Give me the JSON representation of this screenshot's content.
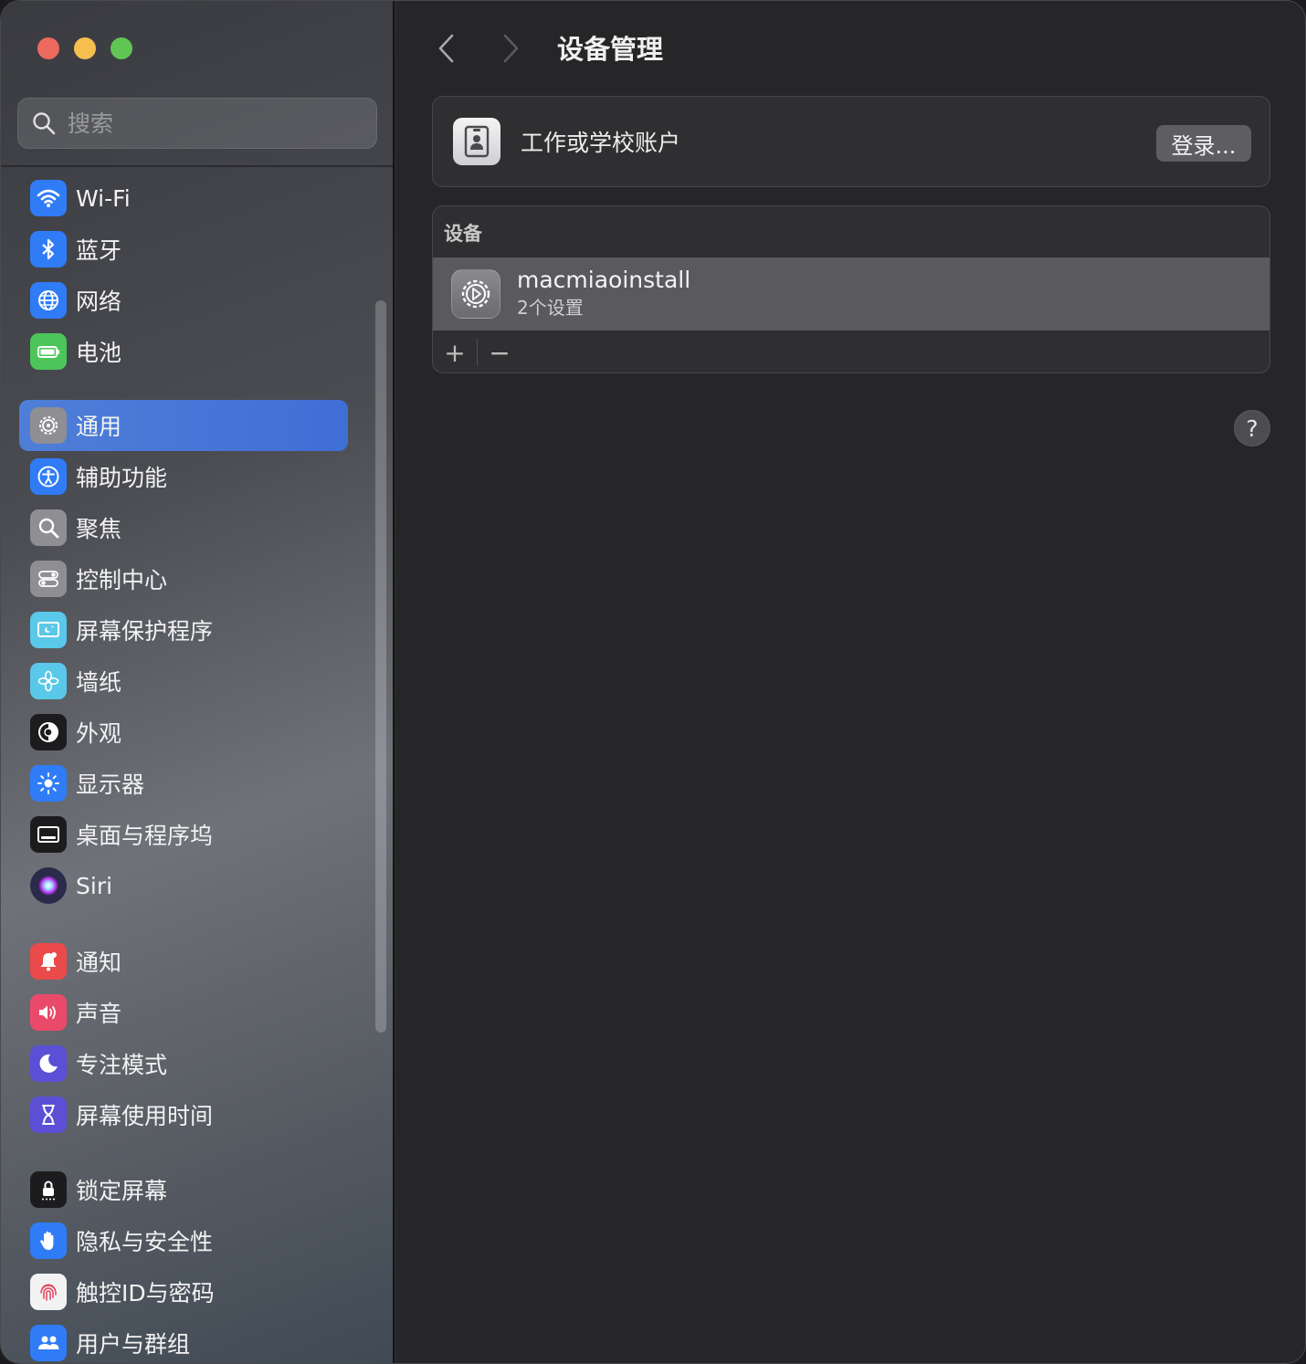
{
  "search": {
    "placeholder": "搜索"
  },
  "sidebar": {
    "items": [
      {
        "label": "Wi-Fi",
        "icon": "wifi-icon",
        "color": "#2f7cf6"
      },
      {
        "label": "蓝牙",
        "icon": "bluetooth-icon",
        "color": "#2f7cf6"
      },
      {
        "label": "网络",
        "icon": "globe-icon",
        "color": "#2f7cf6"
      },
      {
        "label": "电池",
        "icon": "battery-icon",
        "color": "#4cc55a"
      },
      {
        "label": "通用",
        "icon": "gear-icon",
        "color": "#8e8e93",
        "active": true
      },
      {
        "label": "辅助功能",
        "icon": "accessibility-icon",
        "color": "#2f7cf6"
      },
      {
        "label": "聚焦",
        "icon": "spotlight-icon",
        "color": "#8e8e93"
      },
      {
        "label": "控制中心",
        "icon": "toggles-icon",
        "color": "#8e8e93"
      },
      {
        "label": "屏幕保护程序",
        "icon": "screensaver-icon",
        "color": "#5ac8e8"
      },
      {
        "label": "墙纸",
        "icon": "flower-icon",
        "color": "#5ac8e8"
      },
      {
        "label": "外观",
        "icon": "appearance-icon",
        "color": "#1c1c1e"
      },
      {
        "label": "显示器",
        "icon": "sun-icon",
        "color": "#2f7cf6"
      },
      {
        "label": "桌面与程序坞",
        "icon": "dock-icon",
        "color": "#1c1c1e"
      },
      {
        "label": "Siri",
        "icon": "siri-icon",
        "color": "#2a2a4a"
      },
      {
        "label": "通知",
        "icon": "bell-icon",
        "color": "#ea4a4a"
      },
      {
        "label": "声音",
        "icon": "speaker-icon",
        "color": "#ea4a6a"
      },
      {
        "label": "专注模式",
        "icon": "moon-icon",
        "color": "#5b4fd6"
      },
      {
        "label": "屏幕使用时间",
        "icon": "hourglass-icon",
        "color": "#5b4fd6"
      },
      {
        "label": "锁定屏幕",
        "icon": "lock-icon",
        "color": "#1c1c1e"
      },
      {
        "label": "隐私与安全性",
        "icon": "hand-icon",
        "color": "#2f7cf6"
      },
      {
        "label": "触控ID与密码",
        "icon": "fingerprint-icon",
        "color": "#f2f2f2"
      },
      {
        "label": "用户与群组",
        "icon": "users-icon",
        "color": "#2f7cf6"
      }
    ]
  },
  "main": {
    "title": "设备管理",
    "account": {
      "label": "工作或学校账户",
      "button": "登录..."
    },
    "devices": {
      "header": "设备",
      "items": [
        {
          "name": "macmiaoinstall",
          "subtitle": "2个设置"
        }
      ],
      "add": "+",
      "remove": "−"
    },
    "help": "?"
  }
}
